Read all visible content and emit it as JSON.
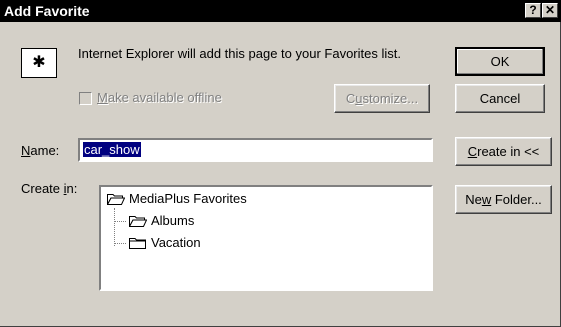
{
  "window": {
    "title": "Add Favorite",
    "help_glyph": "?",
    "close_glyph": "✕"
  },
  "message": "Internet Explorer will add this page to your Favorites list.",
  "favorite_icon": "favorite-star-icon",
  "offline": {
    "pre": "",
    "key": "M",
    "post": "ake available offline",
    "checked": false,
    "enabled": false
  },
  "buttons": {
    "ok": "OK",
    "cancel": "Cancel",
    "customize": {
      "pre": "C",
      "key": "u",
      "post": "stomize..."
    },
    "create_in": {
      "pre": "",
      "key": "C",
      "post": "reate in <<"
    },
    "new_folder": {
      "pre": "Ne",
      "key": "w",
      "post": " Folder..."
    }
  },
  "name": {
    "pre": "",
    "key": "N",
    "post": "ame:",
    "value": "car_show"
  },
  "create_in": {
    "label": {
      "pre": "Create ",
      "key": "i",
      "post": "n:"
    },
    "root": "MediaPlus Favorites",
    "children": [
      "Albums",
      "Vacation"
    ]
  },
  "colors": {
    "dialog_bg": "#d4d0c8",
    "title_bg": "#000000",
    "selection": "#000080"
  }
}
